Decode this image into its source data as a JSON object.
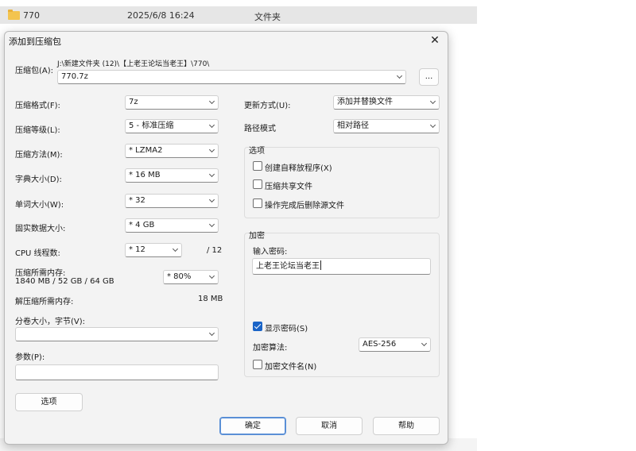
{
  "explorer": {
    "name": "770",
    "date": "2025/6/8 16:24",
    "type": "文件夹"
  },
  "dialog": {
    "title": "添加到压缩包",
    "close": "✕",
    "archive": {
      "label": "压缩包(A):",
      "path": "J:\\新建文件夹 (12)\\【上老王论坛当老王】\\770\\",
      "value": "770.7z",
      "browse": "..."
    },
    "left": {
      "format": {
        "label": "压缩格式(F):",
        "value": "7z"
      },
      "level": {
        "label": "压缩等级(L):",
        "value": "5 - 标准压缩"
      },
      "method": {
        "label": "压缩方法(M):",
        "value": "* LZMA2"
      },
      "dict": {
        "label": "字典大小(D):",
        "value": "* 16 MB"
      },
      "word": {
        "label": "单词大小(W):",
        "value": "* 32"
      },
      "solid": {
        "label": "固实数据大小:",
        "value": "* 4 GB"
      },
      "cpu": {
        "label": "CPU 线程数:",
        "value": "* 12",
        "max": "/ 12"
      },
      "mem_compress": {
        "label": "压缩所需内存:",
        "detail": "1840 MB / 52 GB / 64 GB",
        "value": "* 80%"
      },
      "mem_decompress": {
        "label": "解压缩所需内存:",
        "value": "18 MB"
      },
      "volume": {
        "label": "分卷大小，字节(V):",
        "value": ""
      },
      "params": {
        "label": "参数(P):",
        "value": ""
      },
      "options_button": "选项"
    },
    "right": {
      "update": {
        "label": "更新方式(U):",
        "value": "添加并替换文件"
      },
      "pathmode": {
        "label": "路径模式",
        "value": "相对路径"
      },
      "options": {
        "title": "选项",
        "sfx": {
          "label": "创建自释放程序(X)",
          "checked": false
        },
        "shared": {
          "label": "压缩共享文件",
          "checked": false
        },
        "delete": {
          "label": "操作完成后删除源文件",
          "checked": false
        }
      },
      "encryption": {
        "title": "加密",
        "password_label": "输入密码:",
        "password": "上老王论坛当老王",
        "show_password": {
          "label": "显示密码(S)",
          "checked": true
        },
        "method_label": "加密算法:",
        "method": "AES-256",
        "encrypt_names": {
          "label": "加密文件名(N)",
          "checked": false
        }
      }
    },
    "buttons": {
      "ok": "确定",
      "cancel": "取消",
      "help": "帮助"
    }
  }
}
